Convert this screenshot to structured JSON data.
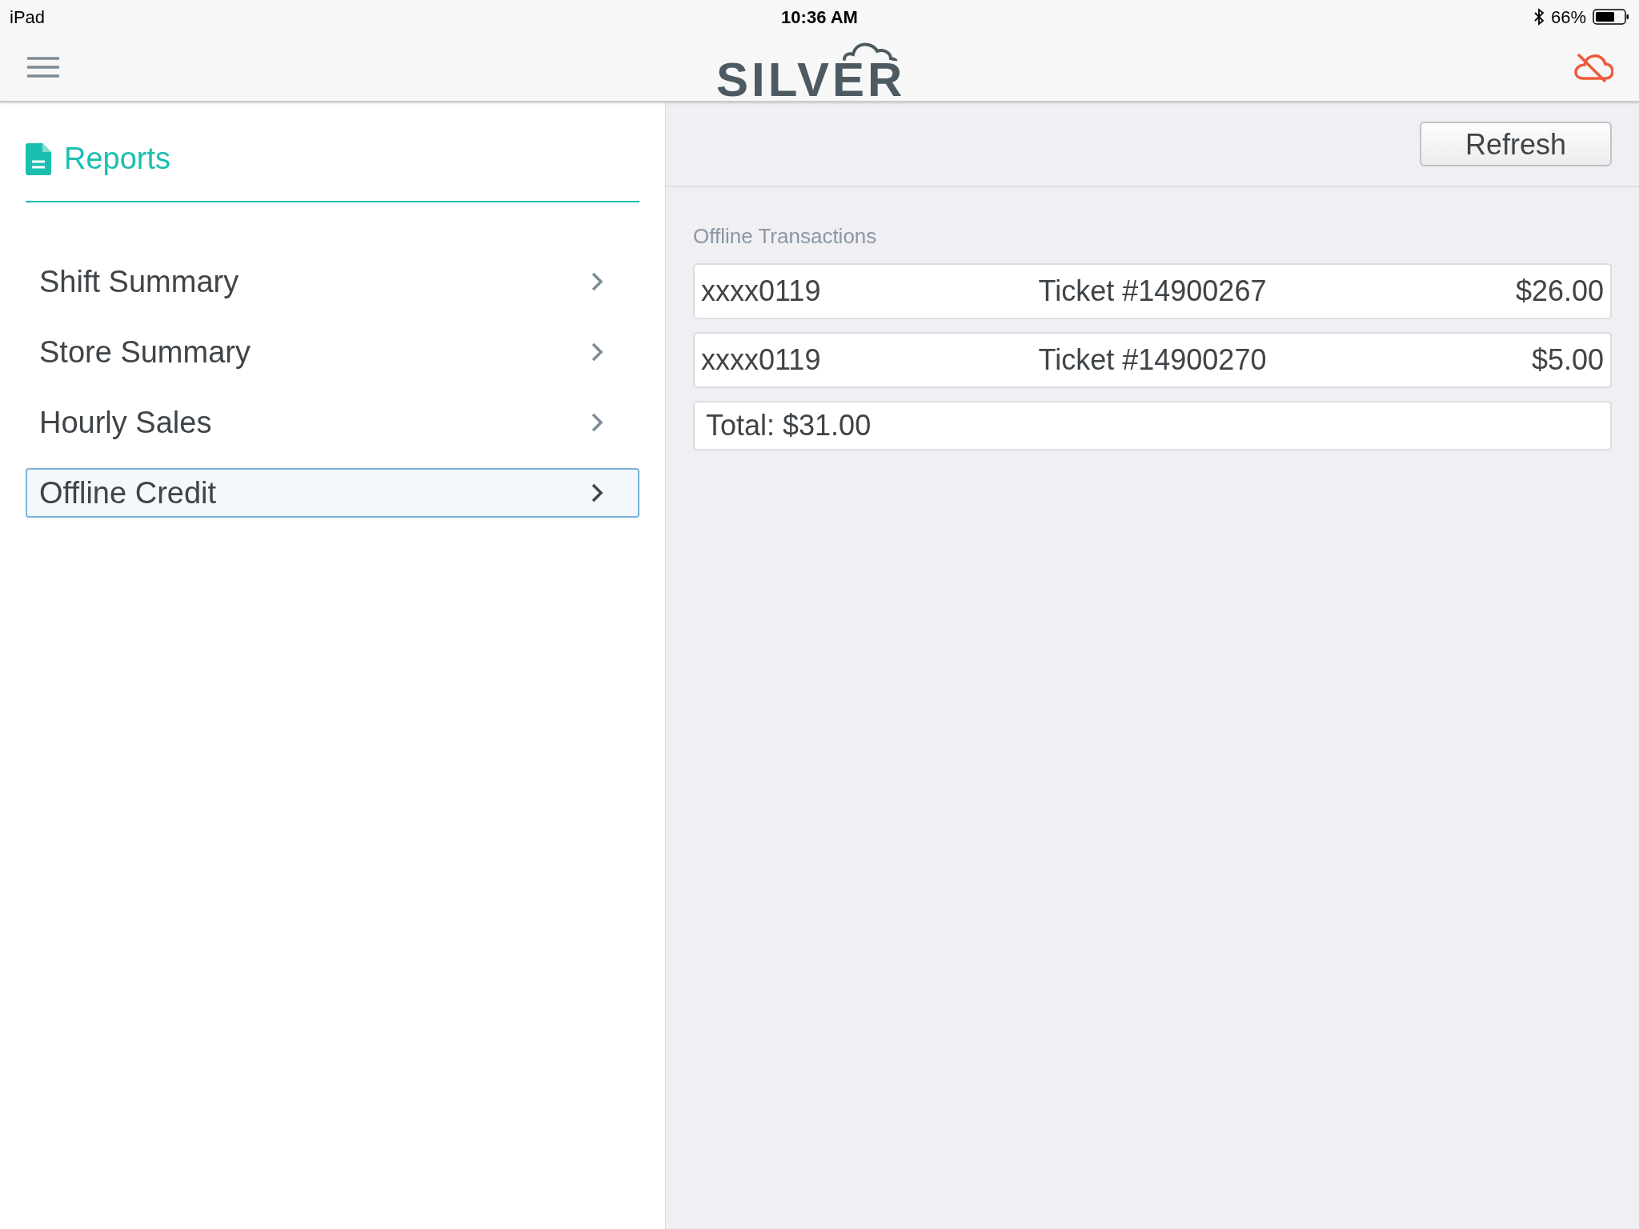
{
  "status_bar": {
    "device": "iPad",
    "time": "10:36 AM",
    "battery": "66%"
  },
  "nav_bar": {
    "logo": "SILVER"
  },
  "sidebar": {
    "title": "Reports",
    "items": [
      {
        "label": "Shift Summary",
        "selected": false
      },
      {
        "label": "Store Summary",
        "selected": false
      },
      {
        "label": "Hourly Sales",
        "selected": false
      },
      {
        "label": "Offline Credit",
        "selected": true
      }
    ]
  },
  "toolbar": {
    "button": "Refresh"
  },
  "offline_transactions": {
    "title": "Offline Transactions",
    "rows": [
      {
        "card": "xxxx0119",
        "ticket": "Ticket #14900267",
        "amount": "$26.00"
      },
      {
        "card": "xxxx0119",
        "ticket": "Ticket #14900270",
        "amount": "$5.00"
      }
    ],
    "total": "Total: $31.00"
  }
}
